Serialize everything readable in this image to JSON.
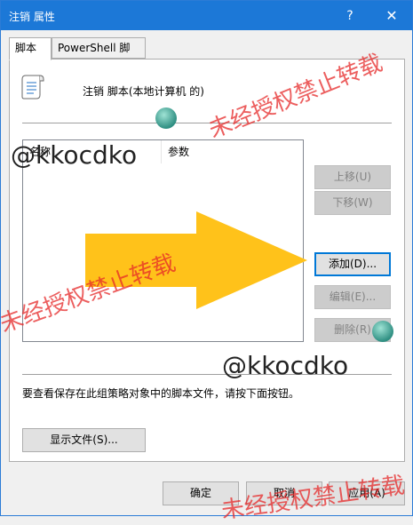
{
  "window": {
    "title": "注销 属性",
    "help_glyph": "?",
    "close_glyph": "✕"
  },
  "tabs": [
    {
      "label": "脚本"
    },
    {
      "label": "PowerShell 脚本"
    }
  ],
  "header": {
    "label": "注销 脚本(本地计算机 的)"
  },
  "script_list": {
    "columns": [
      "名称",
      "参数"
    ],
    "rows": []
  },
  "side_buttons": {
    "up": "上移(U)",
    "down": "下移(W)",
    "add": "添加(D)...",
    "edit": "编辑(E)...",
    "remove": "删除(R)"
  },
  "info_text": "要查看保存在此组策略对象中的脚本文件，请按下面按钮。",
  "show_files_button": "显示文件(S)...",
  "footer": {
    "ok": "确定",
    "cancel": "取消",
    "apply": "应用(A)"
  },
  "overlays": {
    "watermark_text": "未经授权禁止转载",
    "handle_text": "@kkocdko",
    "arrow_color": "#ffc21a",
    "accent_color": "#1c78d7"
  }
}
